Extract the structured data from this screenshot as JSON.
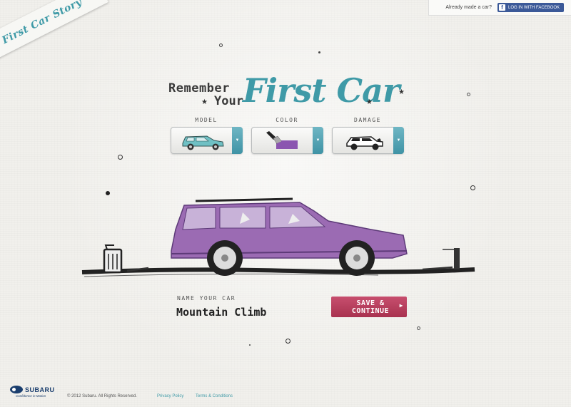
{
  "brand": {
    "ribbon_text": "First Car Story"
  },
  "login": {
    "prompt": "Already made a car?",
    "facebook_label": "LOG IN WITH FACEBOOK"
  },
  "headline": {
    "remember": "Remember",
    "your": "Your",
    "first_car": "First Car"
  },
  "selectors": [
    {
      "label": "MODEL",
      "icon": "wagon-car-icon"
    },
    {
      "label": "COLOR",
      "icon": "paint-brush-icon"
    },
    {
      "label": "DAMAGE",
      "icon": "damaged-car-icon"
    }
  ],
  "car": {
    "color": "#9b6bb3",
    "wheels": "#3a3a3a"
  },
  "name": {
    "label": "NAME YOUR CAR",
    "value": "Mountain Climb"
  },
  "save": {
    "label": "SAVE & CONTINUE"
  },
  "footer": {
    "logo_text": "SUBARU",
    "tagline": "Confidence in Motion",
    "copyright": "© 2012 Subaru. All Rights Reserved.",
    "privacy": "Privacy Policy",
    "terms": "Terms & Conditions"
  },
  "colors": {
    "accent": "#3f9aa7",
    "save": "#b23c59",
    "facebook": "#3b5998"
  }
}
